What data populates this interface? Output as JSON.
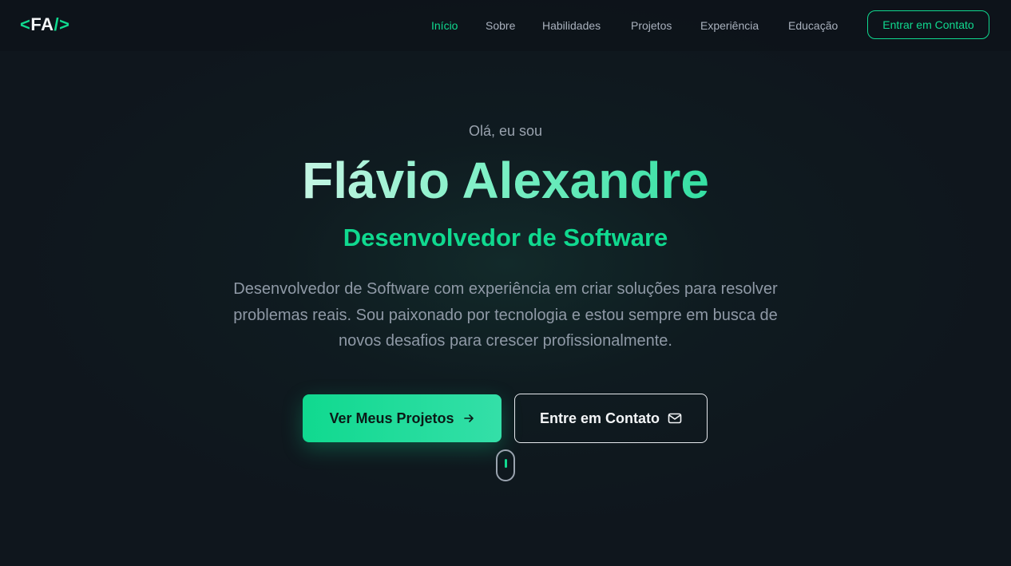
{
  "logo": {
    "open": "<",
    "text": "FA",
    "close": "/>"
  },
  "nav": {
    "items": [
      {
        "label": "Início",
        "active": true
      },
      {
        "label": "Sobre",
        "active": false
      },
      {
        "label": "Habilidades",
        "active": false
      },
      {
        "label": "Projetos",
        "active": false
      },
      {
        "label": "Experiência",
        "active": false
      },
      {
        "label": "Educação",
        "active": false
      }
    ],
    "cta_label": "Entrar em Contato"
  },
  "hero": {
    "greeting": "Olá, eu sou",
    "name": "Flávio Alexandre",
    "role": "Desenvolvedor de Software",
    "description": "Desenvolvedor de Software com experiência em criar soluções para resolver problemas reais. Sou paixonado por tecnologia e estou sempre em busca de novos desafios para crescer profissionalmente.",
    "primary_button": {
      "label": "Ver Meus Projetos",
      "icon": "arrow-right-icon"
    },
    "secondary_button": {
      "label": "Entre em Contato",
      "icon": "mail-icon"
    },
    "scroll_icon": "mouse-scroll-icon"
  },
  "colors": {
    "accent": "#10d98f",
    "background": "#0f161d",
    "text_muted": "#8f99a6"
  }
}
